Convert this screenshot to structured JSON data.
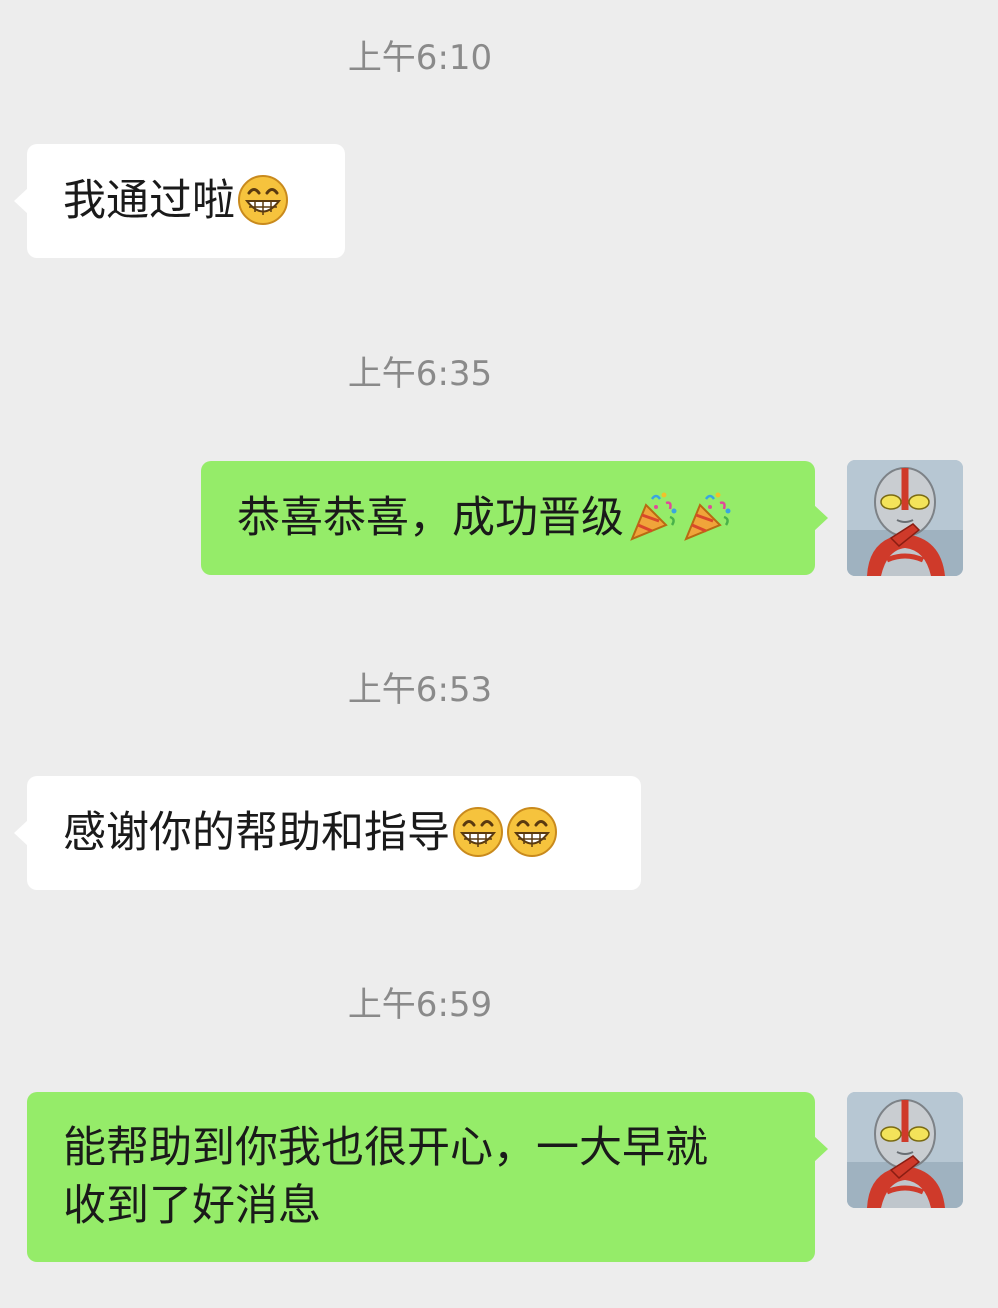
{
  "chat": {
    "messages": [
      {
        "timestamp": "上午6:10",
        "side": "left",
        "text": "我通过啦",
        "emoji": [
          "grin-icon"
        ]
      },
      {
        "timestamp": "上午6:35",
        "side": "right",
        "text": "恭喜恭喜，成功晋级",
        "emoji": [
          "party-popper-icon",
          "party-popper-icon"
        ]
      },
      {
        "timestamp": "上午6:53",
        "side": "left",
        "text": "感谢你的帮助和指导",
        "emoji": [
          "grin-icon",
          "grin-icon"
        ]
      },
      {
        "timestamp": "上午6:59",
        "side": "right",
        "text_line1": "能帮助到你我也很开心，一大早就",
        "text_line2": "收到了好消息",
        "emoji": []
      }
    ]
  },
  "colors": {
    "background": "#ededed",
    "bubble_left": "#ffffff",
    "bubble_right": "#95ec69",
    "timestamp": "#8a8a8a"
  }
}
